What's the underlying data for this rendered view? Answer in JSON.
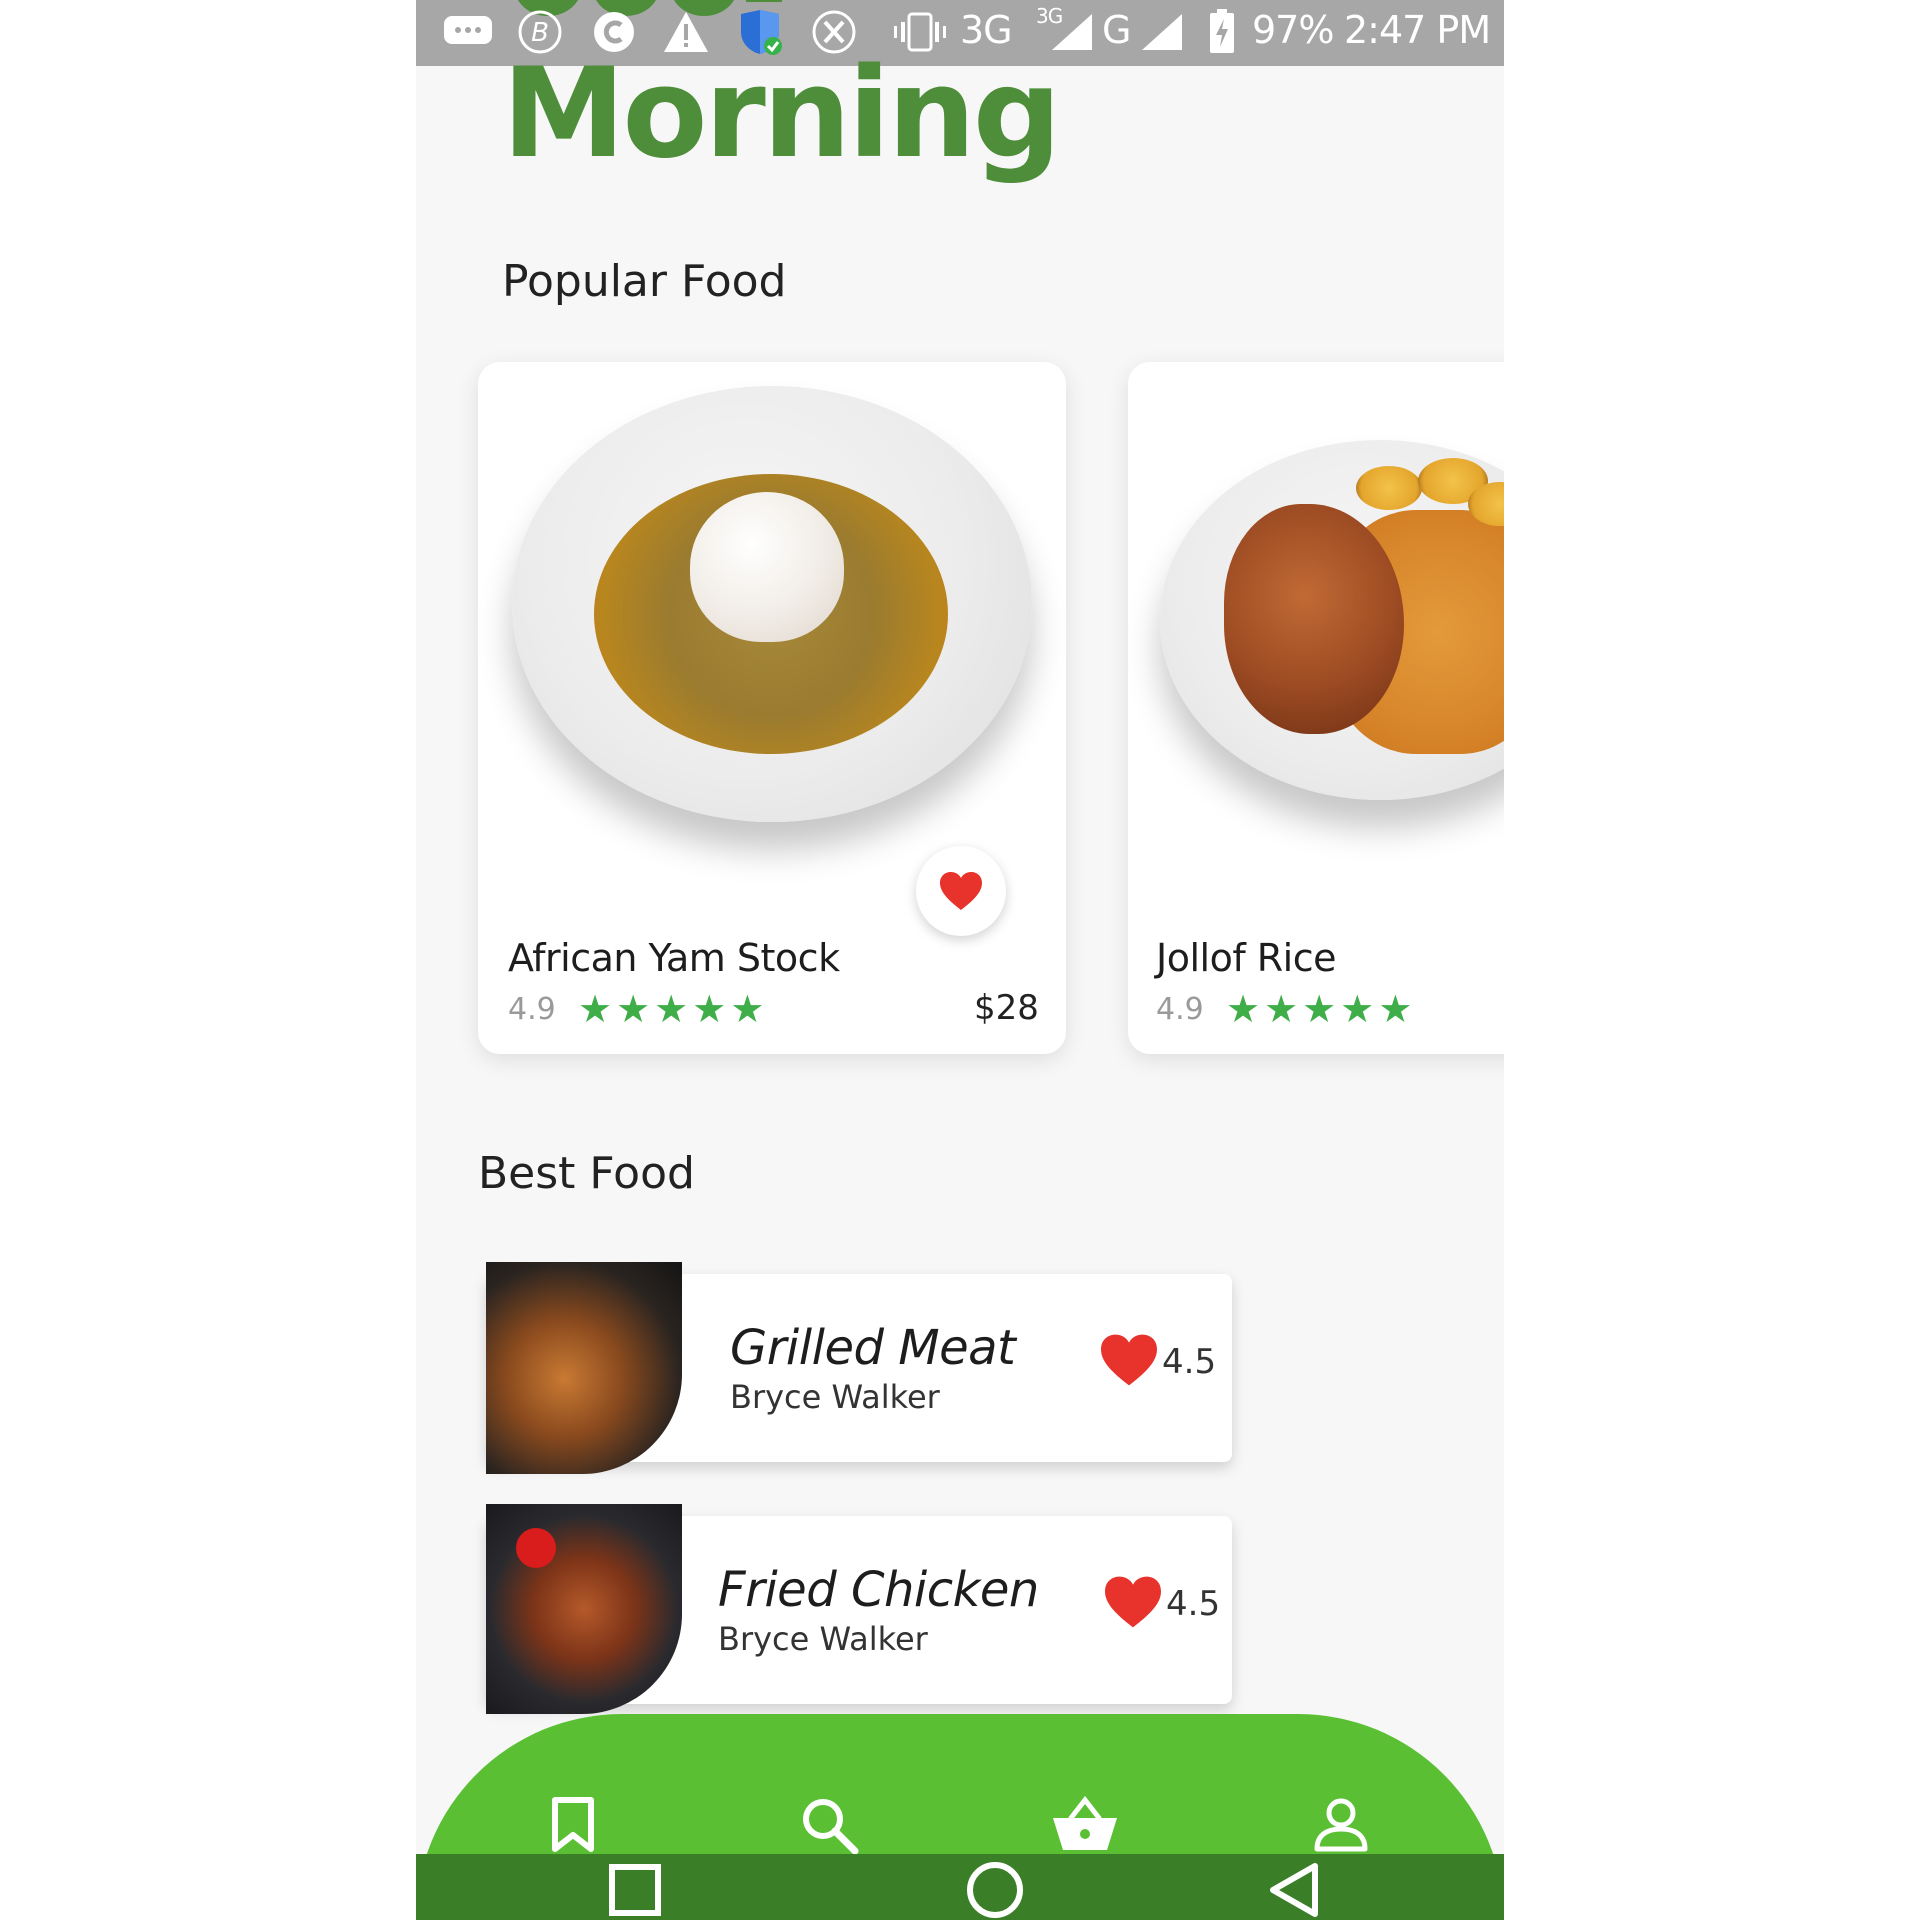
{
  "status_bar": {
    "network": "3G",
    "network_sup": "3G",
    "g_label": "G",
    "battery": "97%",
    "time": "2:47 PM"
  },
  "greeting": "Morning",
  "popular": {
    "title": "Popular Food",
    "items": [
      {
        "name": "African Yam Stock",
        "rating": "4.9",
        "stars": 5,
        "price": "$28",
        "favorited": true
      },
      {
        "name": "Jollof Rice",
        "rating": "4.9",
        "stars": 5
      }
    ]
  },
  "best": {
    "title": "Best Food",
    "items": [
      {
        "name": "Grilled Meat",
        "author": "Bryce Walker",
        "score": "4.5"
      },
      {
        "name": "Fried Chicken",
        "author": "Bryce Walker",
        "score": "4.5"
      }
    ]
  },
  "bottom_nav": [
    "bookmark-icon",
    "search-icon",
    "basket-icon",
    "profile-icon"
  ],
  "system_nav": [
    "recent-apps-icon",
    "home-icon",
    "back-icon"
  ],
  "colors": {
    "brand_green": "#5bbf34",
    "greeting_green": "#4e8d3a",
    "star_green": "#3fae49",
    "heart_red": "#e8322c",
    "status_gray": "#a7a7a7"
  }
}
